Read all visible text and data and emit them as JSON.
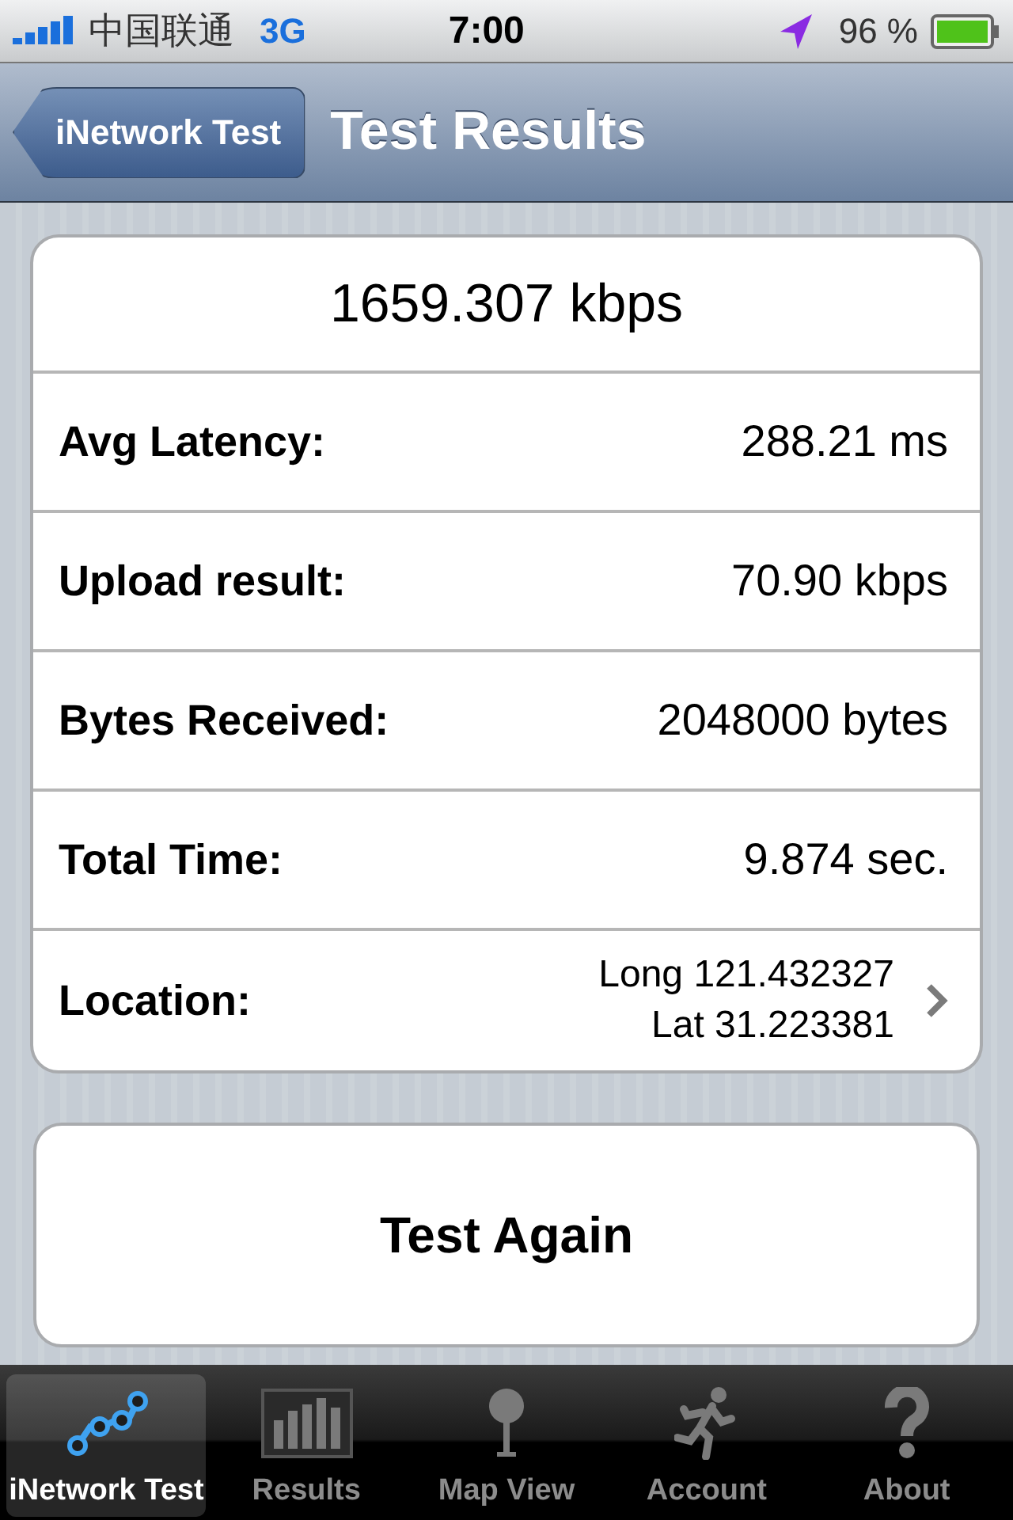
{
  "status_bar": {
    "carrier": "中国联通",
    "network": "3G",
    "time": "7:00",
    "battery": "96 %"
  },
  "nav_bar": {
    "back_button": "iNetwork Test",
    "title": "Test Results"
  },
  "results": {
    "speed": "1659.307 kbps",
    "rows": [
      {
        "kind": "plain",
        "label": "Avg Latency:",
        "value": "288.21 ms"
      },
      {
        "kind": "plain",
        "label": "Upload result:",
        "value": "70.90 kbps"
      },
      {
        "kind": "plain",
        "label": "Bytes Received:",
        "value": "2048000 bytes"
      },
      {
        "kind": "plain",
        "label": "Total Time:",
        "value": "9.874 sec."
      },
      {
        "kind": "detail",
        "label": "Location:",
        "value_lines": [
          "Long 121.432327",
          "Lat 31.223381"
        ]
      }
    ]
  },
  "action_button": "Test Again",
  "tab_bar": [
    {
      "kind": "network",
      "label": "iNetwork Test",
      "selected": true
    },
    {
      "kind": "results",
      "label": "Results",
      "selected": false
    },
    {
      "kind": "map",
      "label": "Map View",
      "selected": false
    },
    {
      "kind": "account",
      "label": "Account",
      "selected": false
    },
    {
      "kind": "about",
      "label": "About",
      "selected": false
    }
  ]
}
